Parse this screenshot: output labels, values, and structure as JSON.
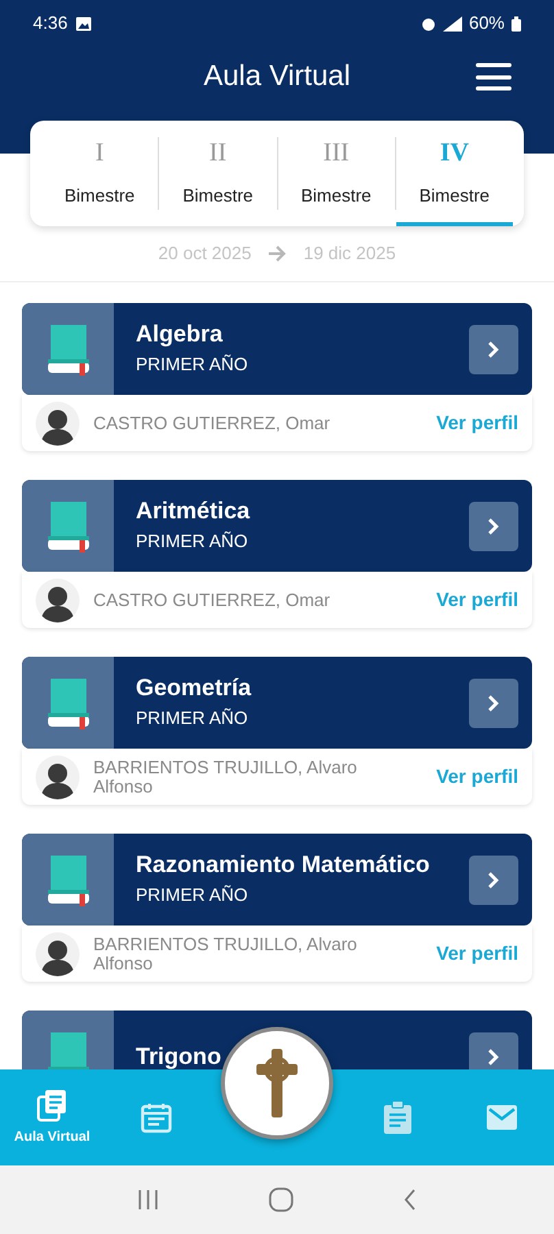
{
  "status_bar": {
    "time": "4:36",
    "battery": "60%"
  },
  "header": {
    "title": "Aula Virtual"
  },
  "tabs": [
    {
      "numeral": "I",
      "label": "Bimestre",
      "selected": false
    },
    {
      "numeral": "II",
      "label": "Bimestre",
      "selected": false
    },
    {
      "numeral": "III",
      "label": "Bimestre",
      "selected": false
    },
    {
      "numeral": "IV",
      "label": "Bimestre",
      "selected": true
    }
  ],
  "date_range": {
    "start": "20 oct 2025",
    "end": "19 dic 2025"
  },
  "courses": [
    {
      "title": "Algebra",
      "subtitle": "PRIMER AÑO",
      "teacher": "CASTRO GUTIERREZ, Omar",
      "link": "Ver perfil"
    },
    {
      "title": "Aritmética",
      "subtitle": "PRIMER AÑO",
      "teacher": "CASTRO GUTIERREZ, Omar",
      "link": "Ver perfil"
    },
    {
      "title": "Geometría",
      "subtitle": "PRIMER AÑO",
      "teacher": "BARRIENTOS TRUJILLO, Alvaro Alfonso",
      "link": "Ver perfil"
    },
    {
      "title": "Razonamiento Matemático",
      "subtitle": "PRIMER AÑO",
      "teacher": "BARRIENTOS TRUJILLO, Alvaro Alfonso",
      "link": "Ver perfil"
    },
    {
      "title": "Trigono"
    }
  ],
  "bottom_nav": [
    {
      "kind": "book",
      "label": "Aula Virtual",
      "selected": true
    },
    {
      "kind": "calendar",
      "selected": false
    },
    {
      "kind": "clipboard",
      "selected": false
    },
    {
      "kind": "mail",
      "selected": false
    }
  ]
}
